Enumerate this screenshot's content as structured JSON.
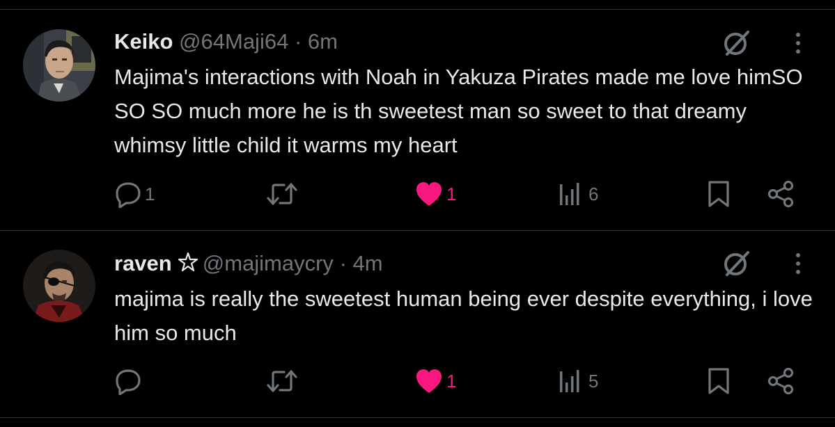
{
  "colors": {
    "background": "#000000",
    "text_primary": "#e7e9ea",
    "text_secondary": "#71767b",
    "like_active": "#f91880",
    "divider": "#2f3336"
  },
  "tweets": [
    {
      "name": "Keiko",
      "handle": "@64Maji64",
      "separator": "·",
      "time": "6m",
      "text": "Majima's interactions with Noah in Yakuza Pirates made me love himSO SO SO much more he is th sweetest man so sweet to that dreamy whimsy little child it warms my heart",
      "reply_count": "1",
      "retweet_count": "",
      "like_count": "1",
      "liked": true,
      "views": "6",
      "icons": [
        "reply-icon",
        "retweet-icon",
        "heart-icon",
        "views-icon",
        "bookmark-icon",
        "share-icon",
        "grok-icon",
        "more-icon"
      ]
    },
    {
      "name": "raven",
      "name_badge": "pentagram-icon",
      "handle": "@majimaycry",
      "separator": "·",
      "time": "4m",
      "text": "majima is really the sweetest human being ever despite everything, i love him so much",
      "reply_count": "",
      "retweet_count": "",
      "like_count": "1",
      "liked": true,
      "views": "5",
      "icons": [
        "reply-icon",
        "retweet-icon",
        "heart-icon",
        "views-icon",
        "bookmark-icon",
        "share-icon",
        "grok-icon",
        "more-icon"
      ]
    }
  ]
}
